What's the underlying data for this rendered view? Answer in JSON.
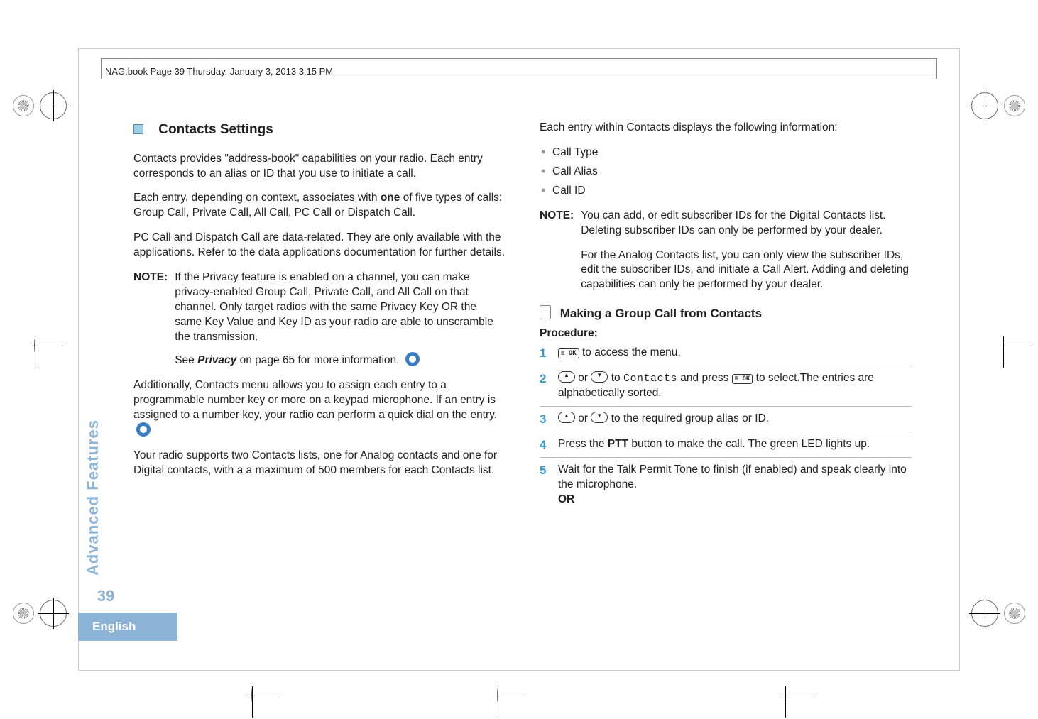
{
  "header": "NAG.book  Page 39  Thursday, January 3, 2013  3:15 PM",
  "side": {
    "section": "Advanced Features",
    "page": "39",
    "language": "English"
  },
  "left": {
    "title": "Contacts Settings",
    "p1": "Contacts provides \"address-book\" capabilities on your radio. Each entry corresponds to an alias or ID that you use to initiate a call.",
    "p2a": "Each entry, depending on context, associates with ",
    "p2b": "one",
    "p2c": " of five types of calls: Group Call, Private Call, All Call, PC Call or Dispatch Call.",
    "p3": "PC Call and Dispatch Call are data-related. They are only available with the applications. Refer to the data applications documentation for further details.",
    "noteLabel": "NOTE:",
    "note1": "If the Privacy feature is enabled on a channel, you can make privacy-enabled Group Call, Private Call, and All Call on that channel. Only target radios with the same Privacy Key OR the same Key Value and Key ID as your radio are able to unscramble the transmission.",
    "note2a": "See ",
    "note2b": "Privacy",
    "note2c": " on page 65 for more information.",
    "p4": "Additionally, Contacts menu allows you to assign each entry to a programmable number key or more on a keypad microphone. If an entry is assigned to a number key, your radio can perform a quick dial on the entry.",
    "p5": "Your radio supports two Contacts lists, one for Analog contacts and one for Digital contacts, with a a maximum of 500 members for each Contacts list."
  },
  "right": {
    "p1": "Each entry within Contacts displays the following information:",
    "bullets": [
      "Call Type",
      "Call Alias",
      "Call ID"
    ],
    "noteLabel": "NOTE:",
    "note1": "You can add, or edit subscriber IDs for the Digital Contacts list. Deleting subscriber IDs can only be performed by your dealer.",
    "note2": "For the Analog Contacts list, you can only view the subscriber IDs, edit the subscriber IDs, and initiate a Call Alert. Adding and deleting capabilities can only be performed by your dealer.",
    "subheading": "Making a Group Call from Contacts",
    "procLabel": "Procedure:",
    "steps": {
      "s1": " to access the menu.",
      "s2a": " or ",
      "s2b": " to ",
      "s2c": "Contacts",
      "s2d": " and press ",
      "s2e": " to select.The entries are alphabetically sorted.",
      "s3a": " or ",
      "s3b": " to the required group alias or ID.",
      "s4a": "Press the ",
      "s4b": "PTT",
      "s4c": " button to make the call. The green LED lights up.",
      "s5": "Wait for the Talk Permit Tone to finish (if enabled) and speak clearly into the microphone.",
      "s5or": "OR"
    },
    "okKey": "≡ OK"
  }
}
